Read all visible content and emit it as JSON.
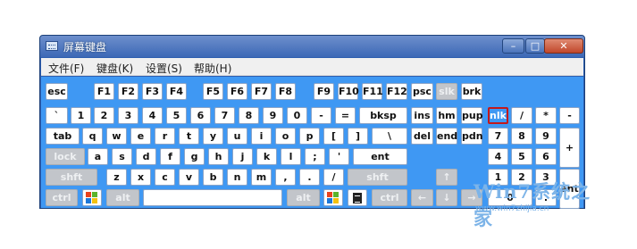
{
  "window": {
    "title": "屏幕键盘",
    "minimize_label": "–",
    "maximize_label": "□",
    "close_label": "✕"
  },
  "menu": [
    "文件(F)",
    "键盘(K)",
    "设置(S)",
    "帮助(H)"
  ],
  "keys": {
    "esc": "esc",
    "f1": "F1",
    "f2": "F2",
    "f3": "F3",
    "f4": "F4",
    "f5": "F5",
    "f6": "F6",
    "f7": "F7",
    "f8": "F8",
    "f9": "F9",
    "f10": "F10",
    "f11": "F11",
    "f12": "F12",
    "psc": "psc",
    "slk": "slk",
    "brk": "brk",
    "grave": "`",
    "d1": "1",
    "d2": "2",
    "d3": "3",
    "d4": "4",
    "d5": "5",
    "d6": "6",
    "d7": "7",
    "d8": "8",
    "d9": "9",
    "d0": "0",
    "minus": "-",
    "equals": "=",
    "bksp": "bksp",
    "ins": "ins",
    "hm": "hm",
    "pup": "pup",
    "nlk": "nlk",
    "np_slash": "/",
    "np_star": "*",
    "np_minus": "-",
    "tab": "tab",
    "q": "q",
    "w": "w",
    "e": "e",
    "r": "r",
    "t": "t",
    "y": "y",
    "u": "u",
    "i": "i",
    "o": "o",
    "p": "p",
    "lbracket": "[",
    "rbracket": "]",
    "backslash": "\\",
    "del": "del",
    "end": "end",
    "pdn": "pdn",
    "np7": "7",
    "np8": "8",
    "np9": "9",
    "np_plus": "+",
    "lock": "lock",
    "a": "a",
    "s": "s",
    "d": "d",
    "f": "f",
    "g": "g",
    "h": "h",
    "j": "j",
    "k": "k",
    "l": "l",
    "semicolon": ";",
    "quote": "'",
    "ent": "ent",
    "np4": "4",
    "np5": "5",
    "np6": "6",
    "lshift": "shft",
    "z": "z",
    "x": "x",
    "c": "c",
    "v": "v",
    "b": "b",
    "n": "n",
    "m": "m",
    "comma": ",",
    "period": ".",
    "slash": "/",
    "rshift": "shft",
    "up": "↑",
    "np1": "1",
    "np2": "2",
    "np3": "3",
    "np_ent": "ent",
    "lctrl": "ctrl",
    "lalt": "alt",
    "space": "",
    "ralt": "alt",
    "rctrl": "ctrl",
    "left": "←",
    "down": "↓",
    "right": "→",
    "np0": "0",
    "np_dot": "."
  },
  "watermark": {
    "logo": "Win7系统之家",
    "url": "www.win7zhijia.cn"
  },
  "colors": {
    "keyboard_bg": "#3f98f3",
    "disabled_key": "#c2c5ca",
    "selected_border": "#c4191a"
  }
}
